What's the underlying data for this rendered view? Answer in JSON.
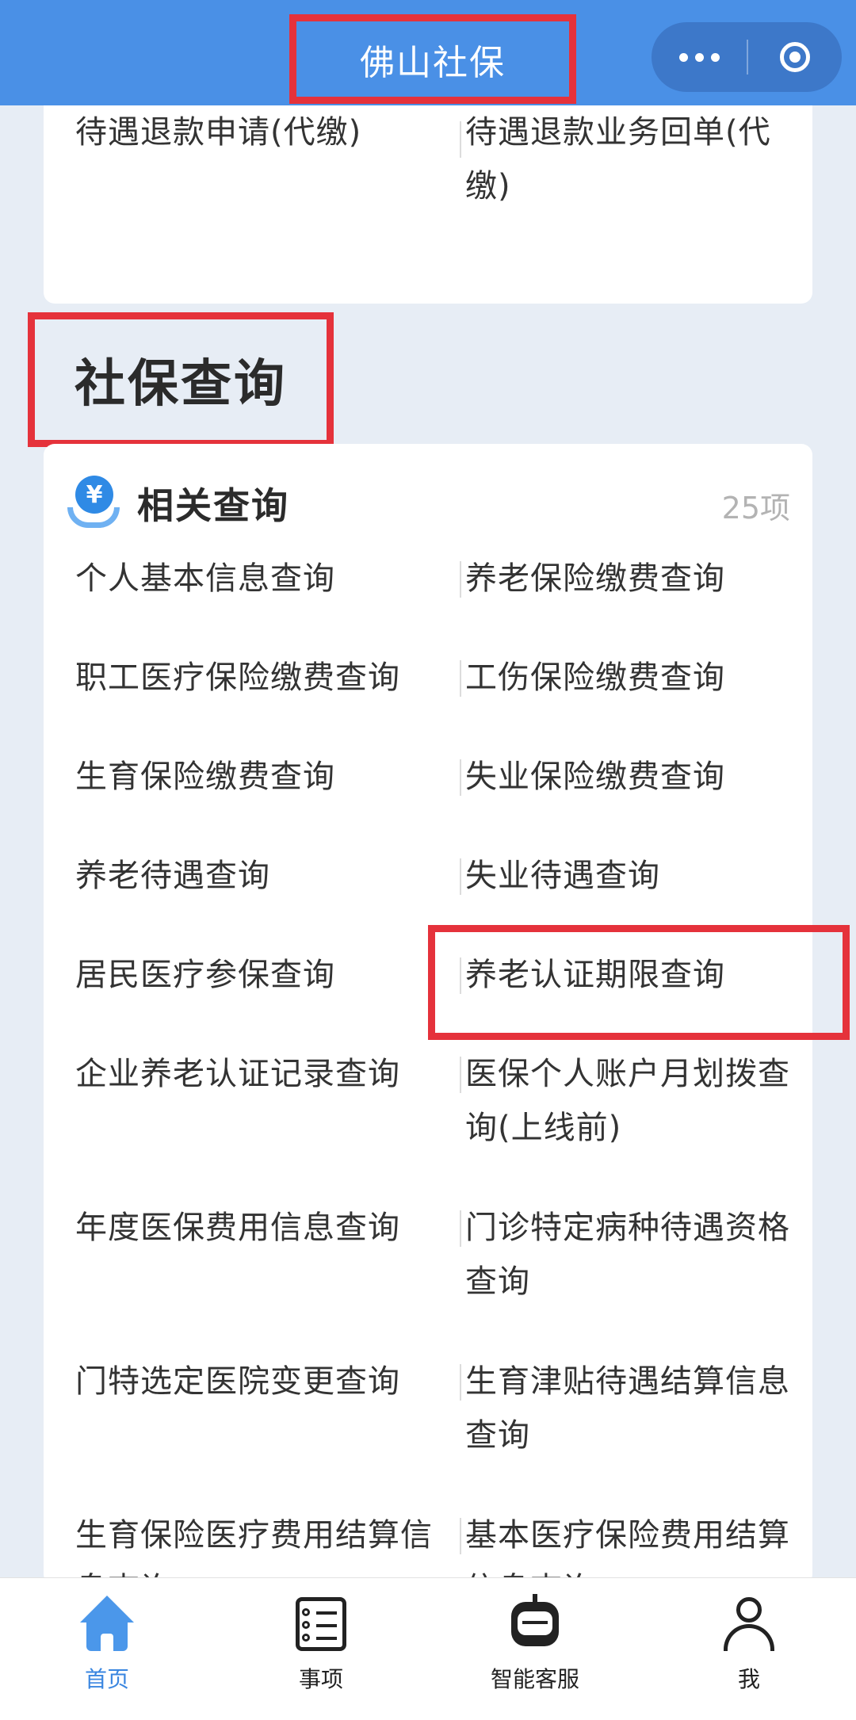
{
  "header": {
    "title": "佛山社保"
  },
  "top_card": {
    "items": [
      {
        "label": "待遇退款申请(代缴)"
      },
      {
        "label": "待遇退款业务回单(代缴)"
      }
    ]
  },
  "section": {
    "title": "社保查询"
  },
  "query_card": {
    "title": "相关查询",
    "count": "25项",
    "items": [
      {
        "label": "个人基本信息查询"
      },
      {
        "label": "养老保险缴费查询"
      },
      {
        "label": "职工医疗保险缴费查询"
      },
      {
        "label": "工伤保险缴费查询"
      },
      {
        "label": "生育保险缴费查询"
      },
      {
        "label": "失业保险缴费查询"
      },
      {
        "label": "养老待遇查询"
      },
      {
        "label": "失业待遇查询"
      },
      {
        "label": "居民医疗参保查询"
      },
      {
        "label": "养老认证期限查询"
      },
      {
        "label": "企业养老认证记录查询"
      },
      {
        "label": "医保个人账户月划拨查询(上线前)"
      },
      {
        "label": "年度医保费用信息查询"
      },
      {
        "label": "门诊特定病种待遇资格查询"
      },
      {
        "label": "门特选定医院变更查询"
      },
      {
        "label": "生育津贴待遇结算信息查询"
      },
      {
        "label": "生育保险医疗费用结算信息查询"
      },
      {
        "label": "基本医疗保险费用结算信息查询"
      }
    ]
  },
  "tabbar": {
    "tabs": [
      {
        "label": "首页",
        "active": true
      },
      {
        "label": "事项"
      },
      {
        "label": "智能客服"
      },
      {
        "label": "我"
      }
    ]
  },
  "colors": {
    "header_bg": "#4a90e6",
    "highlight_red": "#e5323b",
    "active_tab": "#3a86e0"
  }
}
